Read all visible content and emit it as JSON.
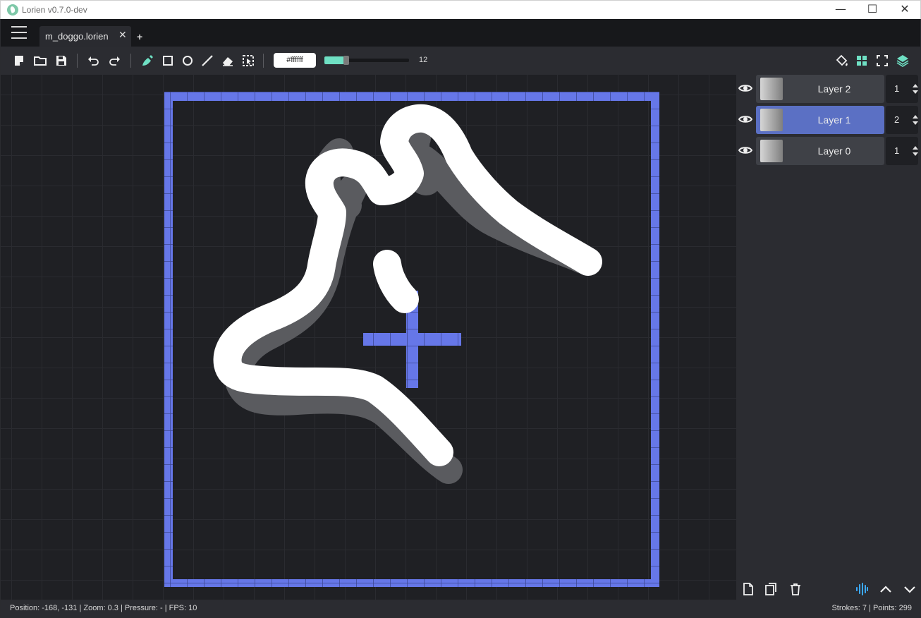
{
  "window": {
    "title": "Lorien v0.7.0-dev",
    "minimize": "—",
    "maximize": "☐",
    "close": "✕"
  },
  "tabs": {
    "active": {
      "label": "m_doggo.lorien",
      "close": "✕"
    },
    "add": "+"
  },
  "toolbar": {
    "color_hex": "#ffffff",
    "brush_size": "12",
    "brush_size_fraction": 0.26,
    "accent_color": "#6fe0c4",
    "icons": [
      "new-file-icon",
      "open-folder-icon",
      "save-icon",
      "undo-icon",
      "redo-icon",
      "brush-icon",
      "rectangle-icon",
      "circle-icon",
      "line-icon",
      "eraser-icon",
      "selection-icon",
      "fill-bucket-icon",
      "grid-icon",
      "fullscreen-icon",
      "layers-icon"
    ]
  },
  "layers": [
    {
      "name": "Layer 2",
      "value": "1",
      "active": false
    },
    {
      "name": "Layer 1",
      "value": "2",
      "active": true
    },
    {
      "name": "Layer 0",
      "value": "1",
      "active": false
    }
  ],
  "colors": {
    "canvas_bg": "#1f2024",
    "frame": "#6677e8",
    "active_layer": "#5b70c4",
    "stroke": "#ffffff",
    "shadow_stroke": "#5a5b5f"
  },
  "status": {
    "left": "Position: -168, -131 | Zoom: 0.3 | Pressure: - | FPS: 10",
    "right": "Strokes: 7 | Points: 299"
  }
}
